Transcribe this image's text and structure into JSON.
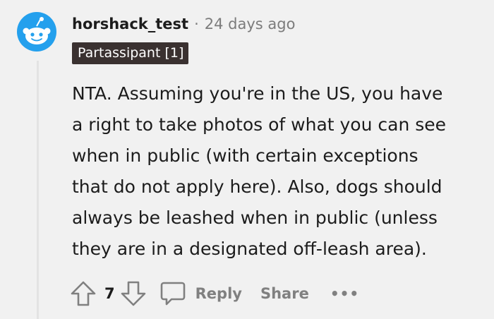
{
  "comment": {
    "username": "horshack_test",
    "separator": "·",
    "timestamp": "24 days ago",
    "flair": "Partassipant [1]",
    "body": [
      "NTA. Assuming you're in the US, you have",
      "a right to take photos of what you can see",
      "when in public (with certain exceptions",
      "that do not apply here). Also, dogs should",
      "always be leashed when in public (unless",
      "they are in a designated off-leash area)."
    ],
    "avatar_icon": "snoo-avatar-icon",
    "colors": {
      "background": "#f1f1f1",
      "flair_background": "#3a3130",
      "flair_text": "#ffffff",
      "muted": "#7c7c7c",
      "avatar_blue": "#24a0ed"
    }
  },
  "actions": {
    "upvote_icon": "upvote-arrow-icon",
    "vote_count": "7",
    "downvote_icon": "downvote-arrow-icon",
    "reply_icon": "speech-bubble-icon",
    "reply_label": "Reply",
    "share_label": "Share",
    "more_label": "•••"
  }
}
